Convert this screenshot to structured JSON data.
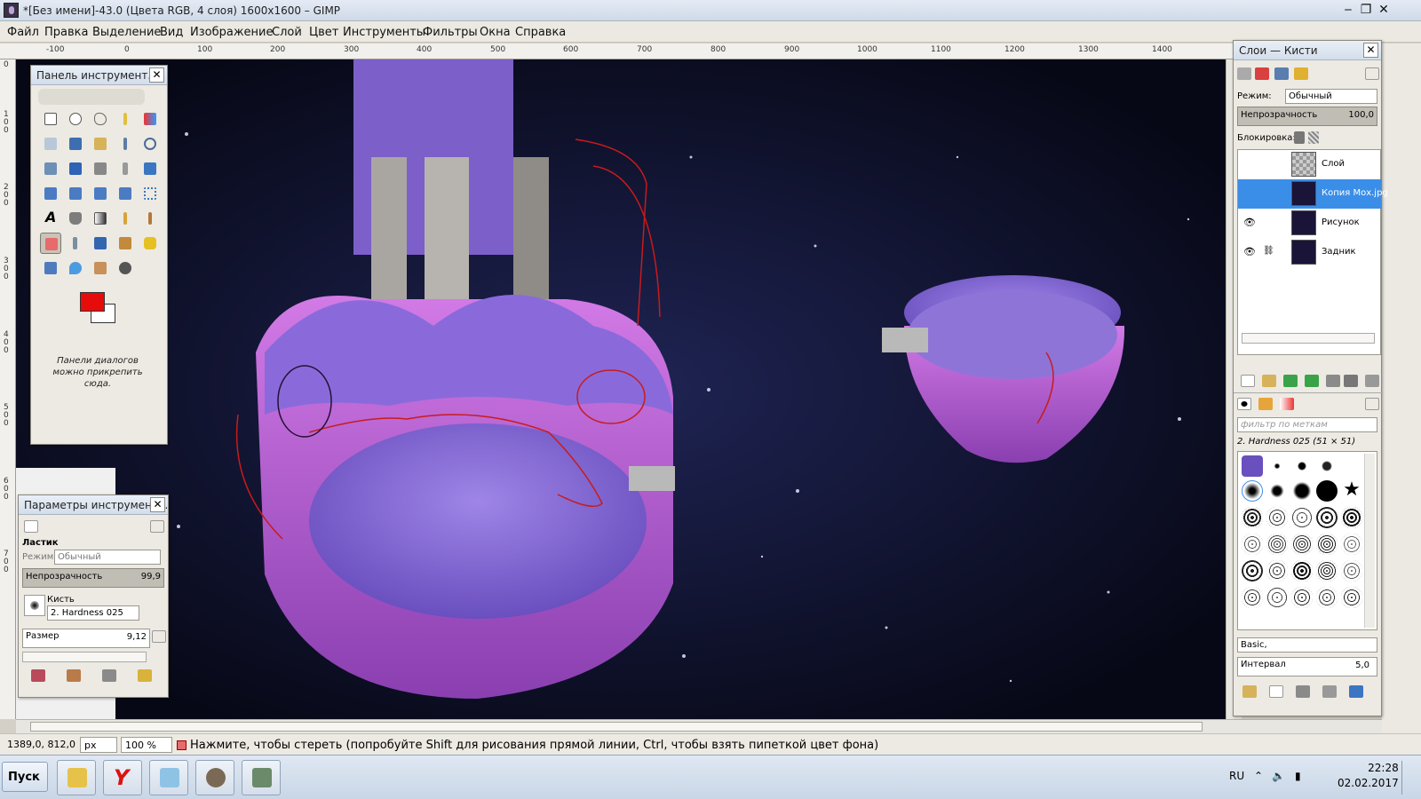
{
  "window": {
    "title": "*[Без имени]-43.0 (Цвета RGB, 4 слоя) 1600x1600 – GIMP",
    "minimize": "‒",
    "maximize": "❐",
    "close": "✕"
  },
  "menu": [
    "Файл",
    "Правка",
    "Выделение",
    "Вид",
    "Изображение",
    "Слой",
    "Цвет",
    "Инструменты",
    "Фильтры",
    "Окна",
    "Справка"
  ],
  "ruler": {
    "h_ticks": [
      "-100",
      "0",
      "100",
      "200",
      "300",
      "400",
      "500",
      "600",
      "700",
      "800",
      "900",
      "1000",
      "1100",
      "1200",
      "1300",
      "1400"
    ],
    "v_ticks": [
      "0",
      "1\n0\n0",
      "2\n0\n0",
      "3\n0\n0",
      "4\n0\n0",
      "5\n0\n0",
      "6\n0\n0",
      "7\n0\n0"
    ]
  },
  "toolbox": {
    "title": "Панель инструмент...",
    "close": "✕",
    "dock_hint": "Панели диалогов можно прикрепить сюда.",
    "fg_color": "#e60c0c",
    "bg_color": "#ffffff",
    "tools": [
      "rect-select",
      "ellipse-select",
      "free-select",
      "fuzzy-select",
      "color-select",
      "scissors",
      "foreground-select",
      "paths",
      "color-picker",
      "zoom",
      "measure",
      "move",
      "align",
      "crop",
      "rotate",
      "scale",
      "shear",
      "perspective",
      "flip",
      "cage",
      "text",
      "bucket-fill",
      "blend",
      "pencil",
      "paintbrush",
      "eraser",
      "airbrush",
      "ink",
      "clone",
      "heal",
      "perspective-clone",
      "blur",
      "smudge",
      "dodge-burn"
    ]
  },
  "tool_options": {
    "title": "Параметры инструмент...",
    "close": "✕",
    "tool_name": "Ластик",
    "mode_label": "Режим:",
    "mode_value": "Обычный",
    "opacity_label": "Непрозрачность",
    "opacity_value": "99,9",
    "brush_label": "Кисть",
    "brush_value": "2. Hardness 025",
    "size_label": "Размер",
    "size_value": "9,12"
  },
  "layers_dock": {
    "title": "Слои — Кисти",
    "close": "✕",
    "mode_label": "Режим:",
    "mode_value": "Обычный",
    "opacity_label": "Непрозрачность",
    "opacity_value": "100,0",
    "lock_label": "Блокировка:",
    "layers": [
      {
        "name": "Слой",
        "visible": false,
        "selected": false
      },
      {
        "name": "Копия Мох.jpg",
        "visible": false,
        "selected": true
      },
      {
        "name": "Рисунок",
        "visible": true,
        "selected": false
      },
      {
        "name": "Задник",
        "visible": true,
        "selected": false
      }
    ],
    "eye_glyph": "👁",
    "chain_glyph": "⛓",
    "filter_placeholder": "фильтр по меткам",
    "brush_current": "2. Hardness 025 (51 × 51)",
    "brush_set": "Basic,",
    "interval_label": "Интервал",
    "interval_value": "5,0"
  },
  "status": {
    "coords": "1389,0, 812,0",
    "unit": "px",
    "zoom": "100 %",
    "message": "Нажмите, чтобы стереть (попробуйте Shift для рисования прямой линии, Ctrl, чтобы взять пипеткой цвет фона)"
  },
  "taskbar": {
    "start_label": "Пуск",
    "apps": [
      "explorer",
      "yandex-browser",
      "notepad",
      "gimp",
      "app"
    ],
    "lang": "RU",
    "time": "22:28",
    "date": "02.02.2017"
  }
}
